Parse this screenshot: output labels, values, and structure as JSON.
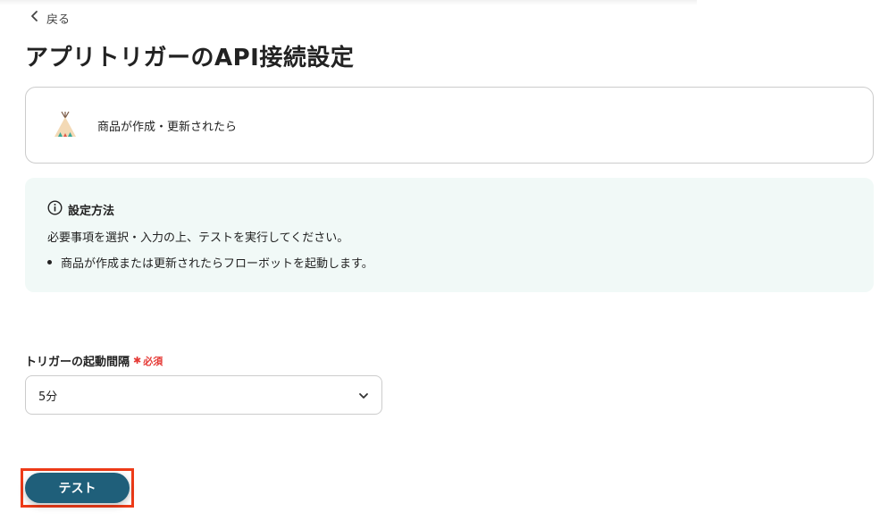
{
  "nav": {
    "back_label": "戻る"
  },
  "header": {
    "title": "アプリトリガーのAPI接続設定"
  },
  "trigger": {
    "app_icon": "tent-icon",
    "label": "商品が作成・更新されたら"
  },
  "info": {
    "heading": "設定方法",
    "description": "必要事項を選択・入力の上、テストを実行してください。",
    "items": [
      "商品が作成または更新されたらフローボットを起動します。"
    ]
  },
  "form": {
    "interval_label": "トリガーの起動間隔",
    "required_label": "必須",
    "interval_value": "5分"
  },
  "actions": {
    "test_label": "テスト"
  },
  "colors": {
    "accent": "#1f5f7a",
    "info_bg": "#f1f9f7",
    "required": "#e53935",
    "highlight": "#ee3b18"
  }
}
